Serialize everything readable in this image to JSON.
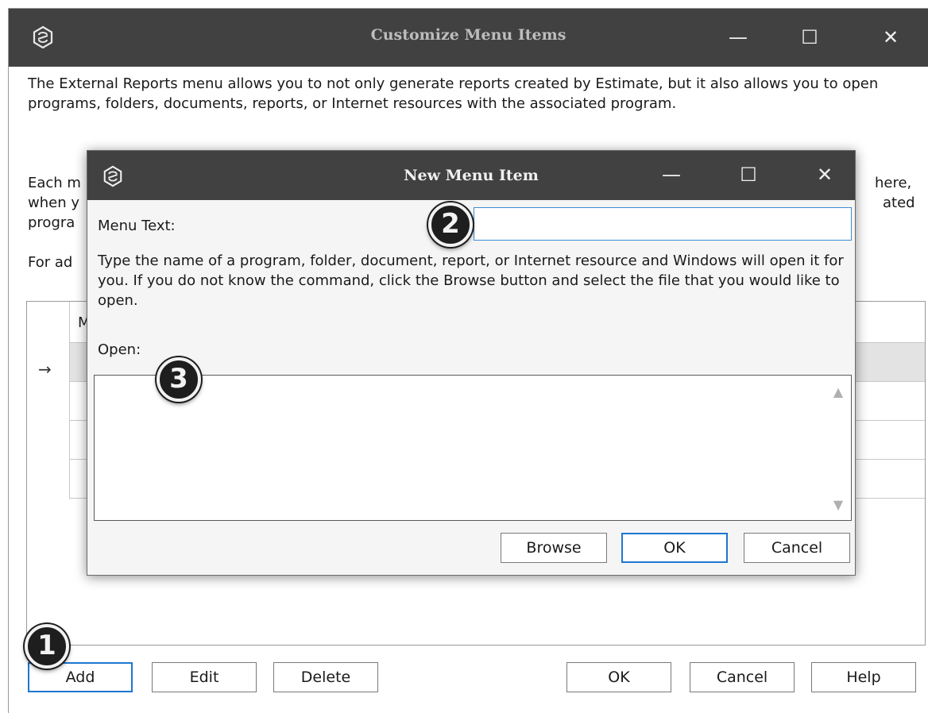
{
  "outer_window": {
    "title": "Customize Menu Items",
    "description": [
      "The External Reports menu allows you to not only generate reports created by Estimate, but it also allows you to open programs, folders, documents, reports, or Internet resources with the associated program.",
      "Each m",
      "when y",
      "progra",
      "For ad"
    ],
    "description_right_fragments": [
      "here,",
      "ated"
    ],
    "grid": {
      "header_fragment": "M",
      "row_indicator": "→"
    },
    "buttons": {
      "add": "Add",
      "edit": "Edit",
      "delete": "Delete",
      "ok": "OK",
      "cancel": "Cancel",
      "help": "Help"
    }
  },
  "dialog": {
    "title": "New Menu Item",
    "menu_text_label": "Menu Text:",
    "menu_text_value": "",
    "instructions": "Type the name of a program, folder, document, report, or Internet resource and Windows will open it for you.  If you do not know the command, click the Browse button and select the file that you would like to open.",
    "open_label": "Open:",
    "open_value": "",
    "buttons": {
      "browse": "Browse",
      "ok": "OK",
      "cancel": "Cancel"
    }
  },
  "window_controls": {
    "minimize": "—",
    "maximize": "☐",
    "close": "✕"
  },
  "callouts": [
    "1",
    "2",
    "3"
  ],
  "colors": {
    "titlebar": "#414141",
    "focus_border": "#1d77d0",
    "callout_bg": "#1e1e1e"
  }
}
